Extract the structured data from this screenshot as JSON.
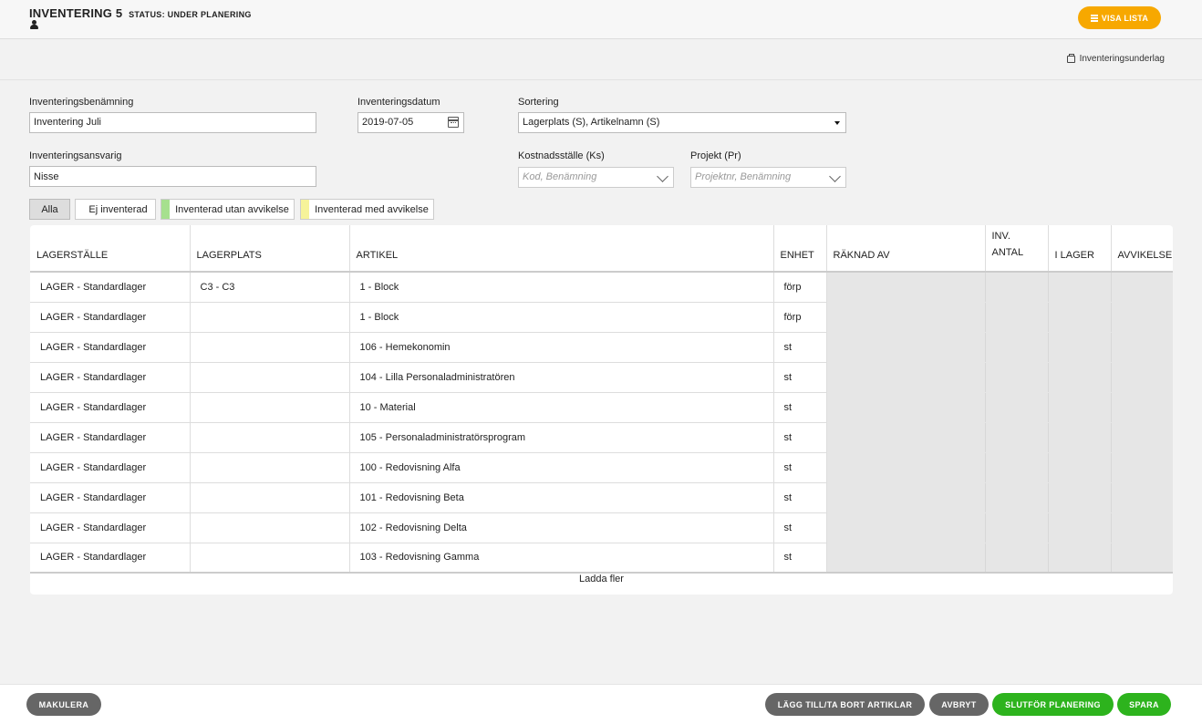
{
  "header": {
    "title": "INVENTERING 5",
    "status": "STATUS: UNDER PLANERING",
    "visa_lista": "VISA LISTA",
    "print_link": "Inventeringsunderlag"
  },
  "form": {
    "name_label": "Inventeringsbenämning",
    "name_value": "Inventering Juli",
    "date_label": "Inventeringsdatum",
    "date_value": "2019-07-05",
    "sort_label": "Sortering",
    "sort_value": "Lagerplats (S), Artikelnamn (S)",
    "resp_label": "Inventeringsansvarig",
    "resp_value": "Nisse",
    "ks_label": "Kostnadsställe (Ks)",
    "ks_placeholder": "Kod, Benämning",
    "pr_label": "Projekt (Pr)",
    "pr_placeholder": "Projektnr, Benämning"
  },
  "filters": {
    "all": "Alla",
    "not_inventoried": "Ej inventerad",
    "without_deviation": "Inventerad utan avvikelse",
    "with_deviation": "Inventerad med avvikelse"
  },
  "colors": {
    "accent_orange": "#f7a800",
    "green": "#2db31d",
    "filter_green": "#a6e08e",
    "filter_yellow": "#f6f39a"
  },
  "table": {
    "columns": [
      "LAGERSTÄLLE",
      "LAGERPLATS",
      "ARTIKEL",
      "ENHET",
      "RÄKNAD AV",
      "INV. ANTAL",
      "I LAGER",
      "AVVIKELSE"
    ],
    "rows": [
      [
        "LAGER - Standardlager",
        "C3 - C3",
        "1 - Block",
        "förp"
      ],
      [
        "LAGER - Standardlager",
        "",
        "1 - Block",
        "förp"
      ],
      [
        "LAGER - Standardlager",
        "",
        "106 - Hemekonomin",
        "st"
      ],
      [
        "LAGER - Standardlager",
        "",
        "104 - Lilla Personaladministratören",
        "st"
      ],
      [
        "LAGER - Standardlager",
        "",
        "10 - Material",
        "st"
      ],
      [
        "LAGER - Standardlager",
        "",
        "105 - Personaladministratörsprogram",
        "st"
      ],
      [
        "LAGER - Standardlager",
        "",
        "100 - Redovisning Alfa",
        "st"
      ],
      [
        "LAGER - Standardlager",
        "",
        "101 - Redovisning Beta",
        "st"
      ],
      [
        "LAGER - Standardlager",
        "",
        "102 - Redovisning Delta",
        "st"
      ],
      [
        "LAGER - Standardlager",
        "",
        "103 - Redovisning Gamma",
        "st"
      ]
    ],
    "load_more": "Ladda fler"
  },
  "footer": {
    "makulera": "MAKULERA",
    "add_remove": "LÄGG TILL/TA BORT ARTIKLAR",
    "cancel": "AVBRYT",
    "finish": "SLUTFÖR PLANERING",
    "save": "SPARA"
  }
}
